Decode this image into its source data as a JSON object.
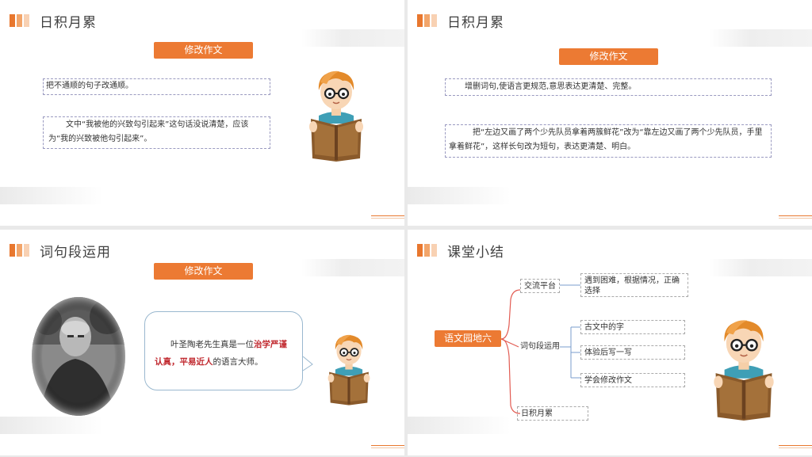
{
  "slides": [
    {
      "title": "日积月累",
      "pill": "修改作文",
      "box1": "把不通顺的句子改通顺。",
      "box2": "文中“我被他的兴致勾引起来”这句话没说清楚，应该为“我的兴致被他勾引起来”。"
    },
    {
      "title": "日积月累",
      "pill": "修改作文",
      "box1": "增删词句,使语言更规范,意思表达更清楚、完整。",
      "box2": "把“左边又画了两个少先队员拿着两簇鲜花”改为“靠左边又画了两个少先队员，手里拿着鲜花”，这样长句改为短句，表达更清楚、明白。"
    },
    {
      "title": "词句段运用",
      "pill": "修改作文",
      "quote_pre": "叶圣陶老先生真是一位",
      "quote_red": "治学严谨认真，平易近人",
      "quote_post": "的语言大师。"
    },
    {
      "title": "课堂小结",
      "root": "语文园地六",
      "branches": [
        {
          "label": "交流平台",
          "children": [
            "遇到困难，根据情况，正确选择"
          ]
        },
        {
          "label": "词句段运用",
          "children": [
            "古文中的字",
            "体验后写一写",
            "学会修改作文"
          ]
        },
        {
          "label": "日积月累",
          "children": []
        }
      ]
    }
  ],
  "colors": {
    "accent": "#ec7a33",
    "red": "#c0272d",
    "dashed": "#9a9ac0"
  }
}
